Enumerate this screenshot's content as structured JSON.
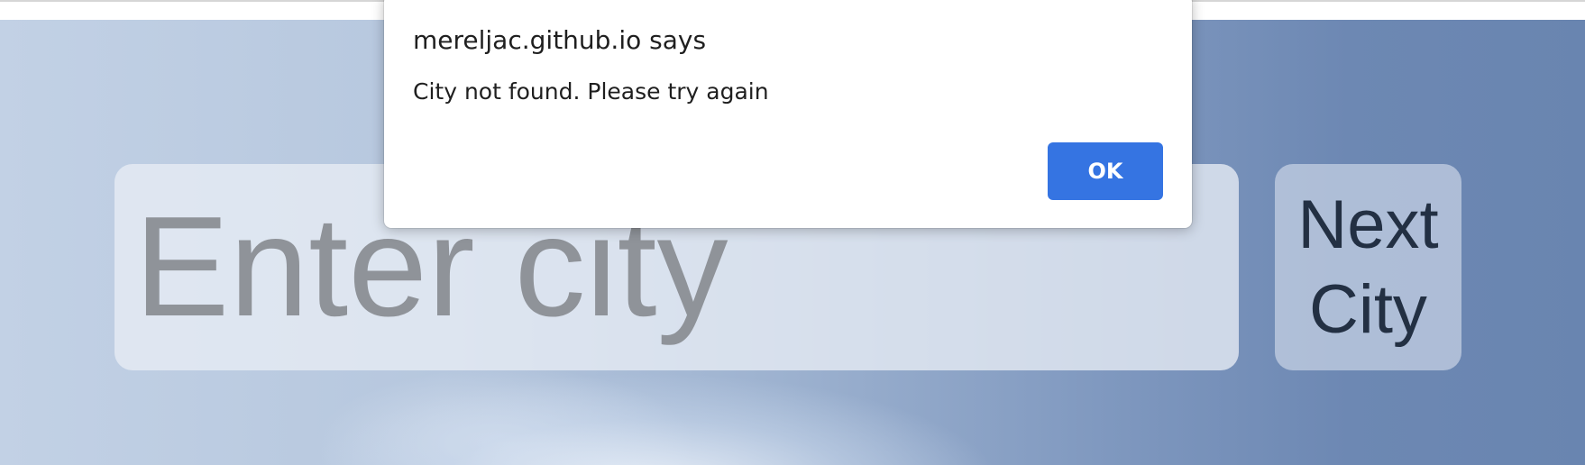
{
  "page": {
    "search": {
      "placeholder": "Enter city",
      "value": ""
    },
    "next_city_button": {
      "label": "Next City"
    }
  },
  "alert": {
    "origin": "mereljac.github.io says",
    "message": "City not found. Please try again",
    "ok_label": "OK"
  },
  "colors": {
    "ok_button": "#3574e2",
    "sky_left": "#c2d1e5",
    "sky_right": "#6985b0",
    "button_text": "#233043",
    "placeholder_text": "#8f9399"
  }
}
